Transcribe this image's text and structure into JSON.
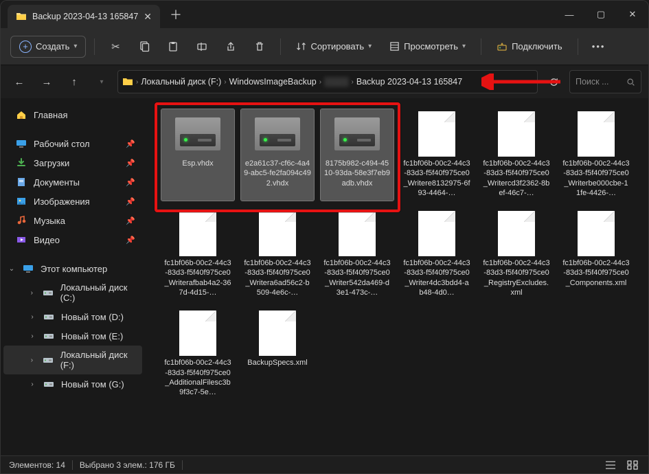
{
  "tab": {
    "title": "Backup 2023-04-13 165847"
  },
  "toolbar": {
    "new_label": "Создать",
    "sort_label": "Сортировать",
    "view_label": "Просмотреть",
    "mount_label": "Подключить"
  },
  "breadcrumb": {
    "segments": [
      "Локальный диск (F:)",
      "WindowsImageBackup",
      "░░░░",
      "Backup 2023-04-13 165847"
    ]
  },
  "search": {
    "placeholder": "Поиск ..."
  },
  "sidebar": {
    "home": "Главная",
    "desktop": "Рабочий стол",
    "downloads": "Загрузки",
    "documents": "Документы",
    "pictures": "Изображения",
    "music": "Музыка",
    "videos": "Видео",
    "this_pc": "Этот компьютер",
    "drives": [
      "Локальный диск (C:)",
      "Новый том (D:)",
      "Новый том (E:)",
      "Локальный диск (F:)",
      "Новый том (G:)"
    ]
  },
  "files": {
    "row1": [
      {
        "name": "Esp.vhdx",
        "type": "vhdx",
        "selected": true
      },
      {
        "name": "e2a61c37-cf6c-4a49-abc5-fe2fa094c492.vhdx",
        "type": "vhdx",
        "selected": true
      },
      {
        "name": "8175b982-c494-4510-93da-58e3f7eb9adb.vhdx",
        "type": "vhdx",
        "selected": true
      },
      {
        "name": "fc1bf06b-00c2-44c3-83d3-f5f40f975ce0_Writere8132975-6f93-4464-…",
        "type": "doc"
      },
      {
        "name": "fc1bf06b-00c2-44c3-83d3-f5f40f975ce0_Writercd3f2362-8bef-46c7-…",
        "type": "doc"
      },
      {
        "name": "fc1bf06b-00c2-44c3-83d3-f5f40f975ce0_Writerbe000cbe-11fe-4426-…",
        "type": "doc"
      }
    ],
    "row2": [
      {
        "name": "fc1bf06b-00c2-44c3-83d3-f5f40f975ce0_Writerafbab4a2-367d-4d15-…",
        "type": "doc"
      },
      {
        "name": "fc1bf06b-00c2-44c3-83d3-f5f40f975ce0_Writera6ad56c2-b509-4e6c-…",
        "type": "doc"
      },
      {
        "name": "fc1bf06b-00c2-44c3-83d3-f5f40f975ce0_Writer542da469-d3e1-473c-…",
        "type": "doc"
      },
      {
        "name": "fc1bf06b-00c2-44c3-83d3-f5f40f975ce0_Writer4dc3bdd4-ab48-4d0…",
        "type": "doc"
      },
      {
        "name": "fc1bf06b-00c2-44c3-83d3-f5f40f975ce0_RegistryExcludes.xml",
        "type": "doc"
      },
      {
        "name": "fc1bf06b-00c2-44c3-83d3-f5f40f975ce0_Components.xml",
        "type": "doc"
      }
    ],
    "row3": [
      {
        "name": "fc1bf06b-00c2-44c3-83d3-f5f40f975ce0_AdditionalFilesc3b9f3c7-5e…",
        "type": "doc"
      },
      {
        "name": "BackupSpecs.xml",
        "type": "doc"
      }
    ]
  },
  "status": {
    "count_label": "Элементов: 14",
    "selection_label": "Выбрано 3 элем.: 176 ГБ"
  }
}
